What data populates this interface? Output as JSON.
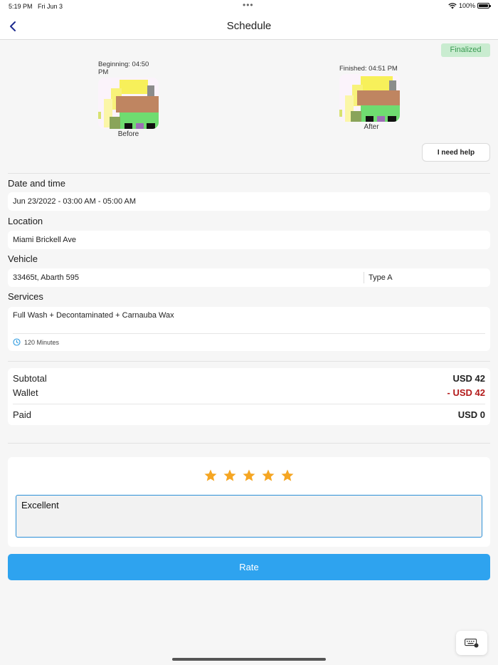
{
  "status_bar": {
    "time": "5:19 PM",
    "date": "Fri Jun 3",
    "battery": "100%"
  },
  "nav": {
    "title": "Schedule"
  },
  "status_badge": "Finalized",
  "photos": {
    "before": {
      "top_caption": "Beginning: 04:50 PM",
      "bottom_caption": "Before"
    },
    "after": {
      "top_caption": "Finished: 04:51 PM",
      "bottom_caption": "After"
    }
  },
  "help_button": "I need help",
  "date_time": {
    "label": "Date and time",
    "value": "Jun 23/2022 - 03:00 AM - 05:00 AM"
  },
  "location": {
    "label": "Location",
    "value": "Miami Brickell Ave"
  },
  "vehicle": {
    "label": "Vehicle",
    "value": "33465t, Abarth 595",
    "type": "Type A"
  },
  "services": {
    "label": "Services",
    "value": "Full Wash + Decontaminated + Carnauba Wax",
    "duration": "120 Minutes"
  },
  "totals": {
    "subtotal_label": "Subtotal",
    "subtotal_value": "USD 42",
    "wallet_label": "Wallet",
    "wallet_value": "- USD 42",
    "paid_label": "Paid",
    "paid_value": "USD 0"
  },
  "rating": {
    "stars": 5,
    "max": 5,
    "star_color": "#f5a623",
    "comment": "Excellent"
  },
  "rate_button": "Rate",
  "colors": {
    "accent": "#2ea3ef",
    "badge_bg": "#c9ecd0",
    "badge_text": "#3a9a52",
    "negative": "#b31a1a"
  }
}
